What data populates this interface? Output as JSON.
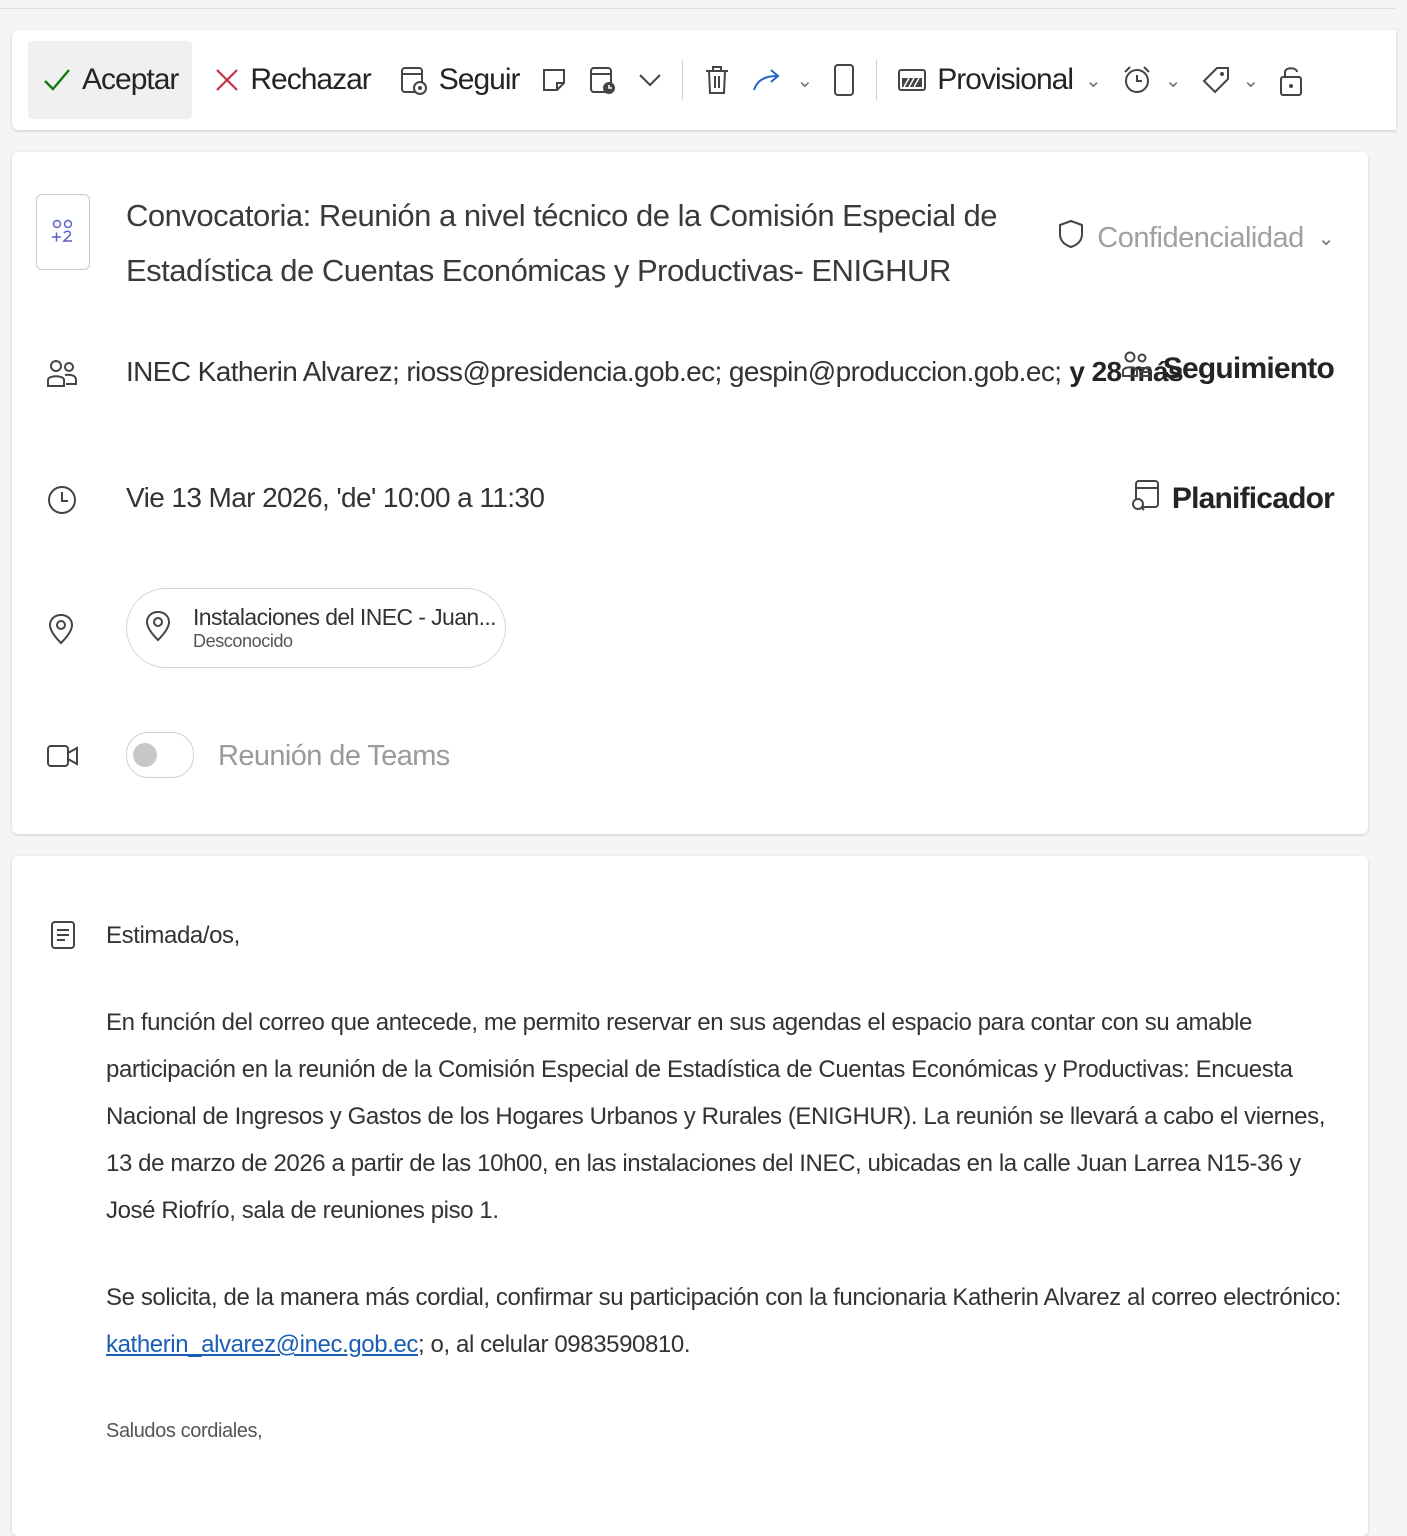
{
  "toolbar": {
    "accept_label": "Aceptar",
    "decline_label": "Rechazar",
    "follow_label": "Seguir",
    "status_label": "Provisional"
  },
  "event": {
    "subject": "Convocatoria: Reunión a nivel técnico de la Comisión Especial de Estadística de Cuentas Económicas y Productivas- ENIGHUR",
    "confidentiality_label": "Confidencialidad",
    "attendees_text": "INEC Katherin Alvarez;  rioss@presidencia.gob.ec;  gespin@produccion.gob.ec;",
    "attendees_more": "y 28 más",
    "tracking_label": "Seguimiento",
    "datetime": "Vie 13 Mar 2026, 'de' 10:00 a 11:30",
    "planner_label": "Planificador",
    "location_title": "Instalaciones del INEC - Juan...",
    "location_status": "Desconocido",
    "teams_label": "Reunión de Teams"
  },
  "body": {
    "greeting": "Estimada/os,",
    "paragraph1": "En función del correo que antecede, me permito reservar en sus agendas el espacio para contar con su amable participación en la reunión de la Comisión Especial de Estadística de Cuentas Económicas y Productivas: Encuesta Nacional de Ingresos y Gastos de los Hogares Urbanos y Rurales (ENIGHUR). La reunión se llevará a cabo el viernes, 13 de marzo de 2026 a partir de las 10h00, en las instalaciones del INEC, ubicadas en la calle Juan Larrea N15-36 y José Riofrío, sala de reuniones piso 1.",
    "paragraph2_prefix": "Se solicita, de la manera más cordial, confirmar su participación con la funcionaria Katherin Alvarez al correo electrónico: ",
    "email_link": "katherin_alvarez@inec.gob.ec",
    "paragraph2_suffix": "; o, al celular 0983590810.",
    "closing": "Saludos cordiales,"
  }
}
